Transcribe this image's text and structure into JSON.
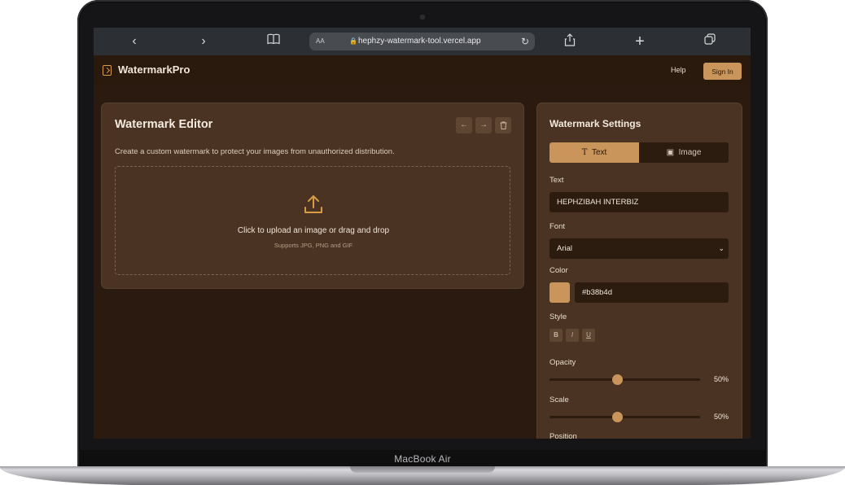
{
  "device": {
    "label": "MacBook Air"
  },
  "browser": {
    "text_size_label": "AA",
    "url": "hephzy-watermark-tool.vercel.app",
    "icons": [
      "chevron-left-icon",
      "chevron-right-icon",
      "book-icon",
      "lock-icon",
      "reload-icon",
      "share-icon",
      "plus-icon",
      "tabs-icon"
    ]
  },
  "header": {
    "brand": "WatermarkPro",
    "help_label": "Help",
    "signin_label": "Sign In"
  },
  "editor": {
    "title": "Watermark Editor",
    "description": "Create a custom watermark to protect your images from unauthorized distribution.",
    "upload_main": "Click to upload an image or drag and drop",
    "upload_sub": "Supports JPG, PNG and GIF"
  },
  "settings": {
    "title": "Watermark Settings",
    "tabs": [
      {
        "label": "Text",
        "icon": "text-icon",
        "active": true
      },
      {
        "label": "Image",
        "icon": "image-icon",
        "active": false
      }
    ],
    "text_label": "Text",
    "text_value": "HEPHZIBAH INTERBIZ",
    "font_label": "Font",
    "font_value": "Arial",
    "color_label": "Color",
    "color_value": "#b38b4d",
    "style_label": "Style",
    "style_buttons": [
      "B",
      "I",
      "U"
    ],
    "opacity_label": "Opacity",
    "opacity_value": "50%",
    "opacity_fraction": 0.45,
    "scale_label": "Scale",
    "scale_value": "50%",
    "scale_fraction": 0.45,
    "position_label": "Position"
  },
  "colors": {
    "accent": "#c9955a",
    "background": "#2b1a0f",
    "card": "#4a3322"
  }
}
